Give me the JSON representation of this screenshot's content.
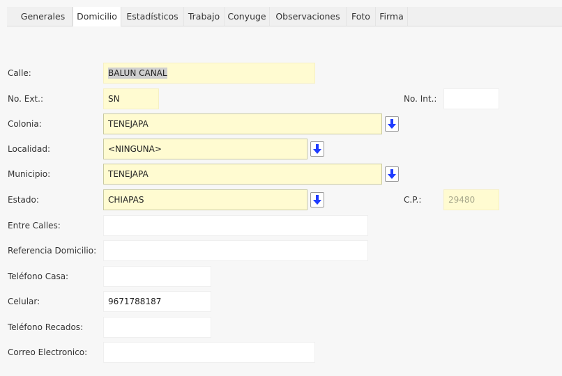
{
  "tabs": [
    {
      "label": "Generales"
    },
    {
      "label": "Domicilio"
    },
    {
      "label": "Estadísticos"
    },
    {
      "label": "Trabajo"
    },
    {
      "label": "Conyuge"
    },
    {
      "label": "Observaciones"
    },
    {
      "label": "Foto"
    },
    {
      "label": "Firma"
    }
  ],
  "active_tab": "Domicilio",
  "form": {
    "calle": {
      "label": "Calle:",
      "value": "BALUN CANAL"
    },
    "no_ext": {
      "label": "No. Ext.:",
      "value": "SN"
    },
    "no_int": {
      "label": "No. Int.:",
      "value": ""
    },
    "colonia": {
      "label": "Colonia:",
      "value": "TENEJAPA"
    },
    "localidad": {
      "label": "Localidad:",
      "value": "<NINGUNA>"
    },
    "municipio": {
      "label": "Municipio:",
      "value": "TENEJAPA"
    },
    "estado": {
      "label": "Estado:",
      "value": "CHIAPAS"
    },
    "cp": {
      "label": "C.P.:",
      "value": "29480"
    },
    "entre_calles": {
      "label": "Entre Calles:",
      "value": ""
    },
    "referencia": {
      "label": "Referencia Domicilio:",
      "value": ""
    },
    "telefono_casa": {
      "label": "Teléfono Casa:",
      "value": ""
    },
    "celular": {
      "label": "Celular:",
      "value": "9671788187"
    },
    "telefono_recados": {
      "label": "Teléfono Recados:",
      "value": ""
    },
    "correo": {
      "label": "Correo Electronico:",
      "value": ""
    }
  },
  "icons": {
    "dropdown": "arrow-down-icon"
  },
  "colors": {
    "input_yellow": "#fffbd1",
    "arrow_blue": "#1f3cff"
  }
}
